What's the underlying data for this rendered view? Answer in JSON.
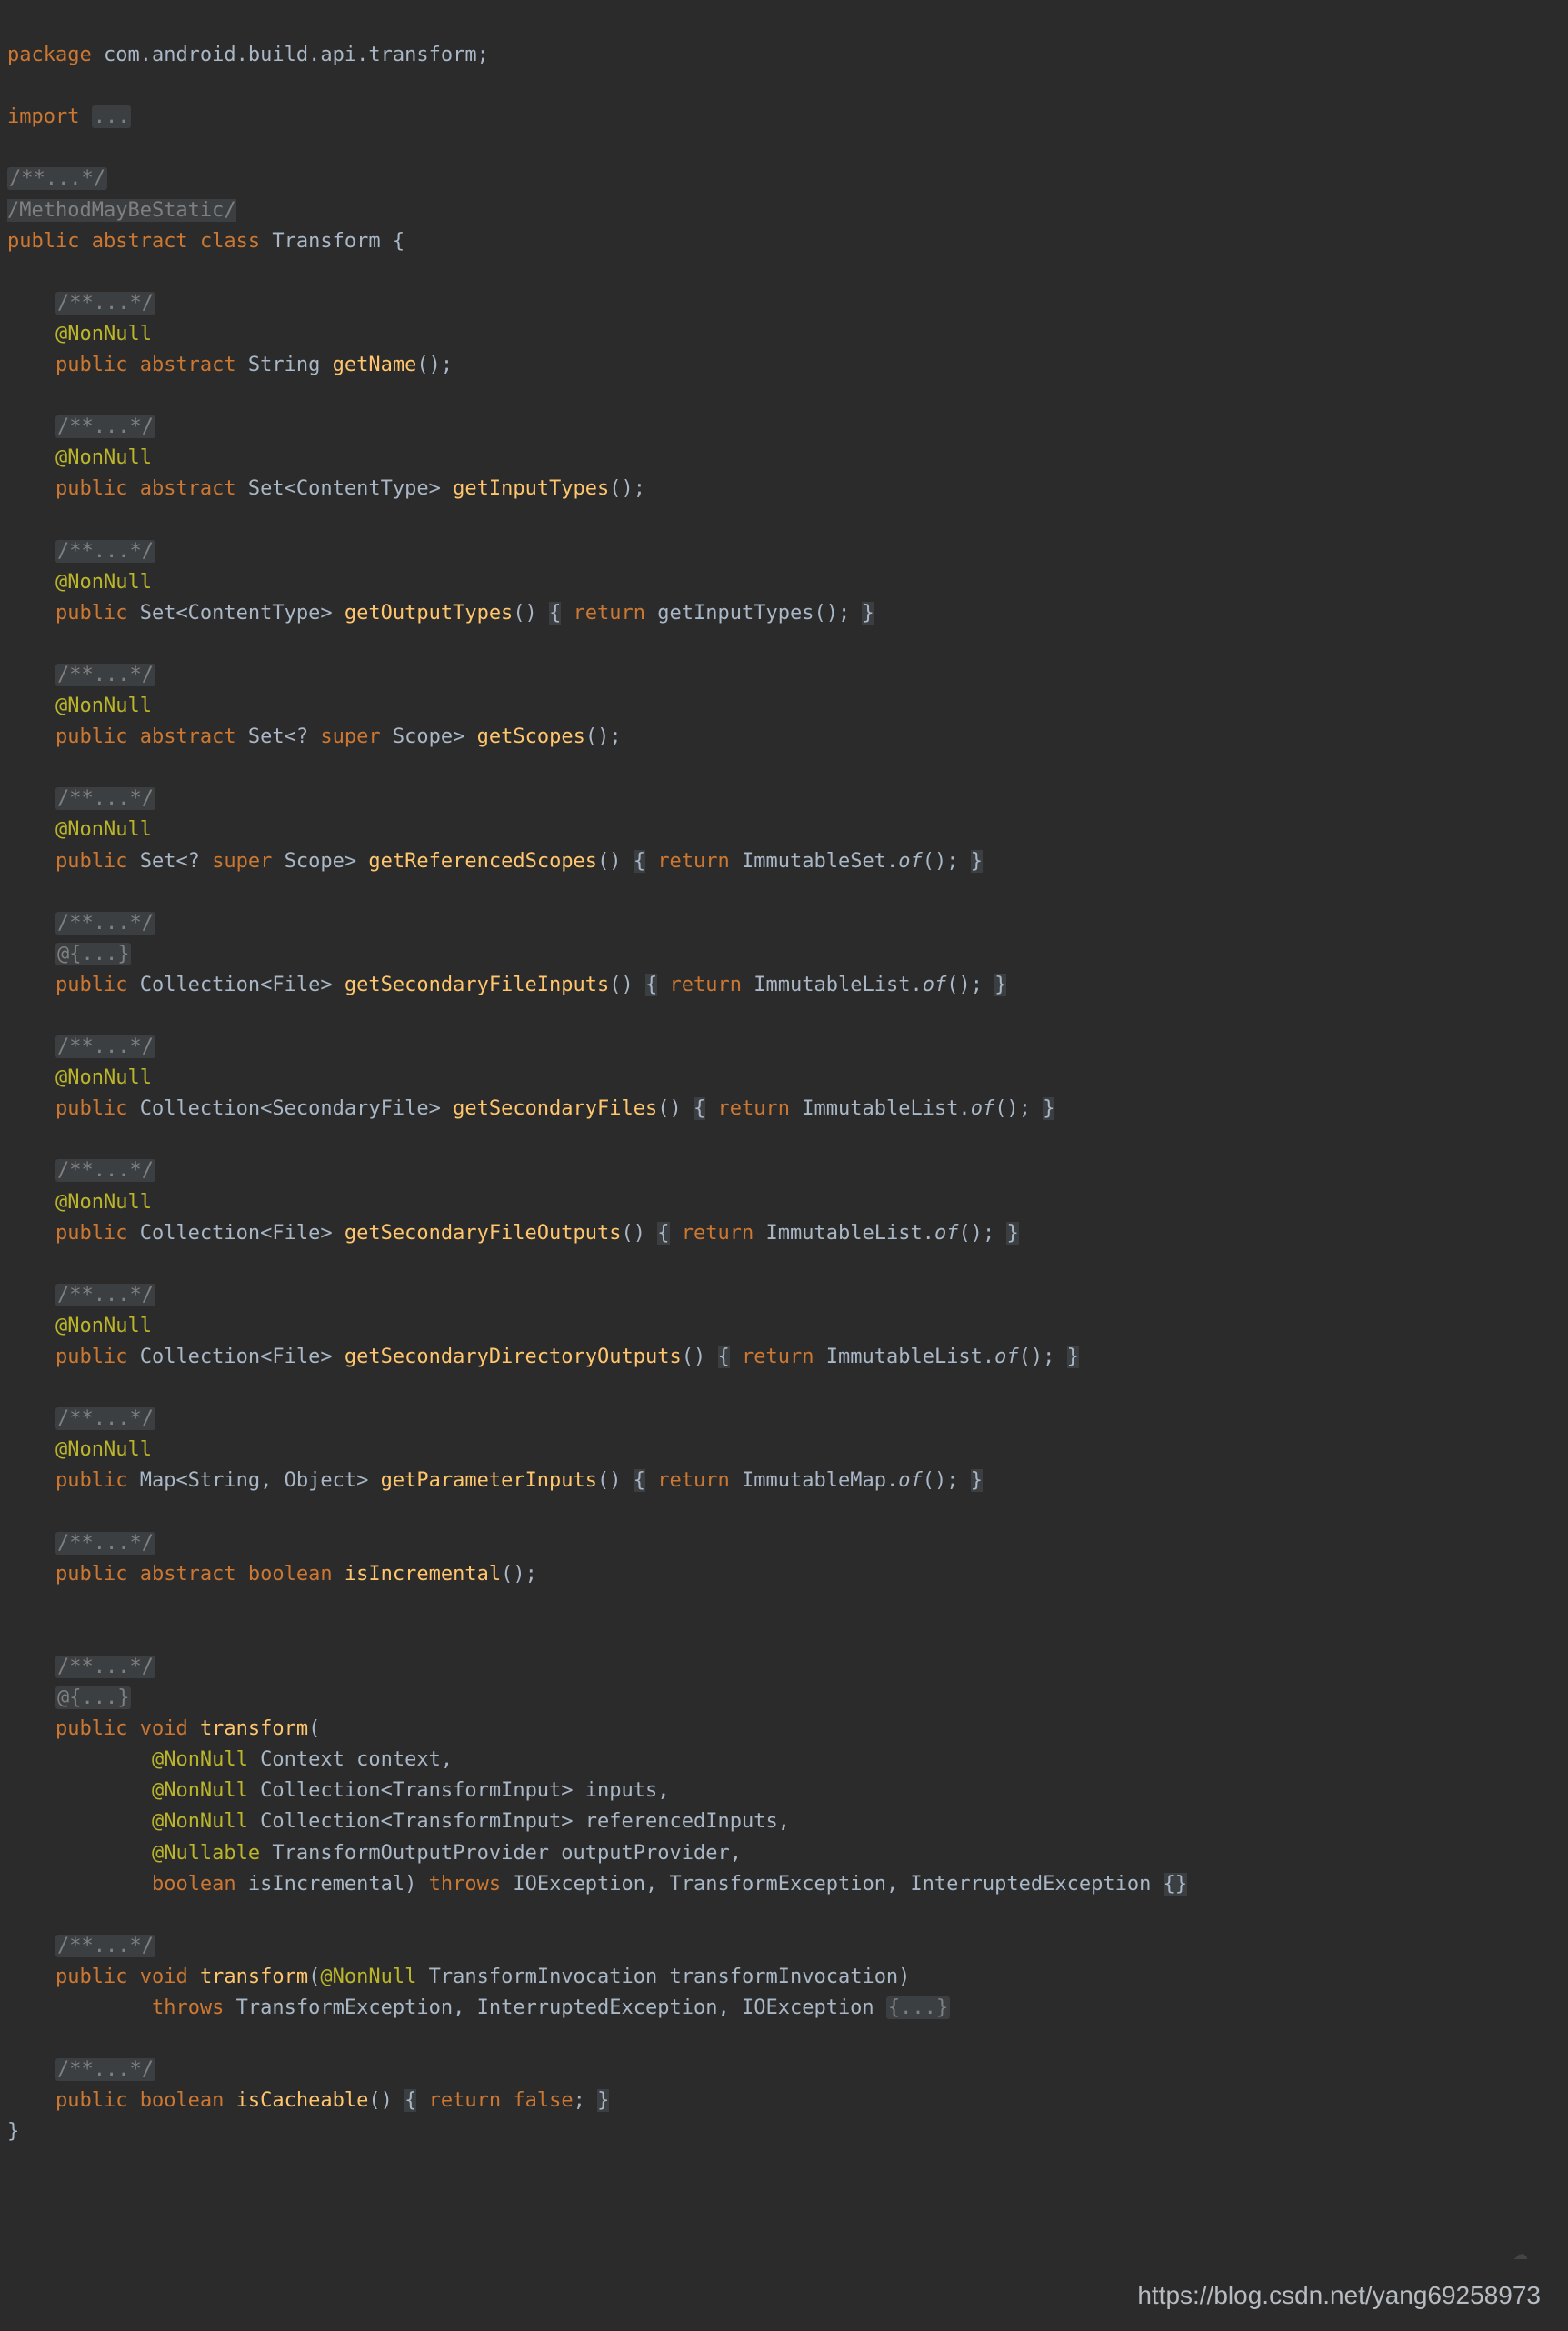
{
  "watermark": "https://blog.csdn.net/yang69258973",
  "code": {
    "pkg_kw": "package ",
    "pkg_name": "com.android.build.api.transform",
    "semi": ";",
    "import_kw": "import ",
    "import_fold": "...",
    "javadoc_fold": "/**...*/",
    "inspect": "/MethodMayBeStatic/",
    "public": "public ",
    "abstract": "abstract ",
    "class_kw": "class ",
    "class_name": "Transform",
    "open_brace": " {",
    "close_brace": "}",
    "nn": "@NonNull",
    "nullable": "@Nullable",
    "annfold": "@{...}",
    "string_t": "String",
    "set_ct": "Set<ContentType>",
    "set_scope_w": "Set<? ",
    "super_kw": "super",
    "scope_tail": " Scope>",
    "coll_file": "Collection<File>",
    "coll_sf": "Collection<SecondaryFile>",
    "coll_ti": "Collection<TransformInput>",
    "map_so": "Map<String, Object>",
    "boolean_t": "boolean",
    "void_t": "void",
    "return_kw": "return",
    "throws_kw": "throws",
    "false_kw": "false",
    "m_getName": "getName",
    "m_getInputTypes": "getInputTypes",
    "m_getOutputTypes": "getOutputTypes",
    "m_getScopes": "getScopes",
    "m_getReferencedScopes": "getReferencedScopes",
    "m_getSecondaryFileInputs": "getSecondaryFileInputs",
    "m_getSecondaryFiles": "getSecondaryFiles",
    "m_getSecondaryFileOutputs": "getSecondaryFileOutputs",
    "m_getSecondaryDirectoryOutputs": "getSecondaryDirectoryOutputs",
    "m_getParameterInputs": "getParameterInputs",
    "m_isIncremental": "isIncremental",
    "m_transform": "transform",
    "m_isCacheable": "isCacheable",
    "call_getInputTypes": "getInputTypes()",
    "call_ImSet_of": "ImmutableSet.",
    "call_ImList_of": "ImmutableList.",
    "call_ImMap_of": "ImmutableMap.",
    "of_it": "of",
    "parens_empty": "()",
    "parens_close_semi": "();",
    "ctx": " Context context,",
    "inputs": " inputs,",
    "refinputs": " referencedInputs,",
    "top": " TransformOutputProvider outputProvider,",
    "isinc": " isIncremental)",
    "throws_list1": " IOException, TransformException, InterruptedException ",
    "empty_body": "{}",
    "tinv_param": " TransformInvocation transformInvocation)",
    "throws_list2": " TransformException, InterruptedException, IOException ",
    "body_fold": "{...}",
    "sp": " "
  }
}
